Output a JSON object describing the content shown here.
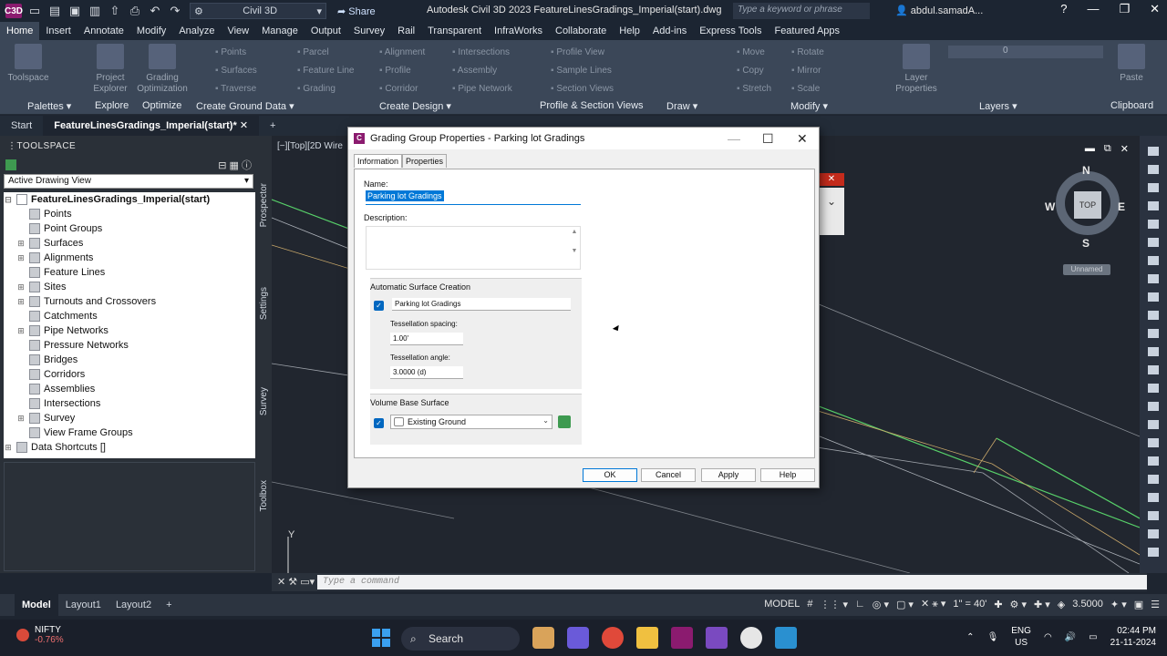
{
  "titlebar": {
    "logo": "C3D",
    "workspace": "Civil 3D",
    "share": "Share",
    "title": "Autodesk Civil 3D 2023    FeatureLinesGradings_Imperial(start).dwg",
    "search_placeholder": "Type a keyword or phrase",
    "user": "abdul.samadA..."
  },
  "ribbon_tabs": [
    "Home",
    "Insert",
    "Annotate",
    "Modify",
    "Analyze",
    "View",
    "Manage",
    "Output",
    "Survey",
    "Rail",
    "Transparent",
    "InfraWorks",
    "Collaborate",
    "Help",
    "Add-ins",
    "Express Tools",
    "Featured Apps"
  ],
  "ribbon": {
    "big_buttons": [
      "Toolspace",
      "Project Explorer",
      "Grading Optimization",
      "Layer Properties",
      "Paste"
    ],
    "small_buttons": [
      "Points",
      "Surfaces",
      "Traverse",
      "Parcel",
      "Feature Line",
      "Grading",
      "Alignment",
      "Profile",
      "Corridor",
      "Intersections",
      "Assembly",
      "Pipe Network",
      "Profile View",
      "Sample Lines",
      "Section Views",
      "Move",
      "Copy",
      "Stretch",
      "Rotate",
      "Mirror",
      "Scale"
    ],
    "layer_value": "0",
    "panel_titles": [
      "Palettes",
      "Explore",
      "Optimize",
      "Create Ground Data",
      "Create Design",
      "Profile & Section Views",
      "Draw",
      "Modify",
      "Layers",
      "Clipboard"
    ]
  },
  "doc_tabs": [
    "Start",
    "FeatureLinesGradings_Imperial(start)*"
  ],
  "toolspace": {
    "title": "TOOLSPACE",
    "view_select": "Active Drawing View",
    "root": "FeatureLinesGradings_Imperial(start)",
    "items": [
      "Points",
      "Point Groups",
      "Surfaces",
      "Alignments",
      "Feature Lines",
      "Sites",
      "Turnouts and Crossovers",
      "Catchments",
      "Pipe Networks",
      "Pressure Networks",
      "Bridges",
      "Corridors",
      "Assemblies",
      "Intersections",
      "Survey",
      "View Frame Groups"
    ],
    "data_shortcuts": "Data Shortcuts []",
    "side_tabs": [
      "Prospector",
      "Settings",
      "Survey",
      "Toolbox"
    ]
  },
  "canvas": {
    "view_label": "[−][Top][2D Wire",
    "compass": {
      "n": "N",
      "s": "S",
      "e": "E",
      "w": "W",
      "top": "TOP"
    },
    "ucs_label": "Unnamed",
    "ucs_axis": "Y"
  },
  "cmdline": {
    "placeholder": "Type a command"
  },
  "statusbar": {
    "layouts": [
      "Model",
      "Layout1",
      "Layout2"
    ],
    "model": "MODEL",
    "scale": "1\" = 40'",
    "value": "3.5000"
  },
  "taskbar": {
    "ticker": "NIFTY",
    "change": "-0.76%",
    "search": "Search",
    "lang1": "ENG",
    "lang2": "US",
    "time": "02:44 PM",
    "date": "21-11-2024"
  },
  "dialog": {
    "title": "Grading Group Properties - Parking lot Gradings",
    "tabs": [
      "Information",
      "Properties"
    ],
    "name_label": "Name:",
    "name_value": "Parking lot Gradings",
    "description_label": "Description:",
    "auto_surface_label": "Automatic Surface Creation",
    "auto_surface_name": "Parking lot Gradings",
    "tess_spacing_label": "Tessellation spacing:",
    "tess_spacing_value": "1.00'",
    "tess_angle_label": "Tessellation angle:",
    "tess_angle_value": "3.0000 (d)",
    "volume_base_label": "Volume Base Surface",
    "volume_base_value": "Existing Ground",
    "buttons": {
      "ok": "OK",
      "cancel": "Cancel",
      "apply": "Apply",
      "help": "Help"
    }
  }
}
